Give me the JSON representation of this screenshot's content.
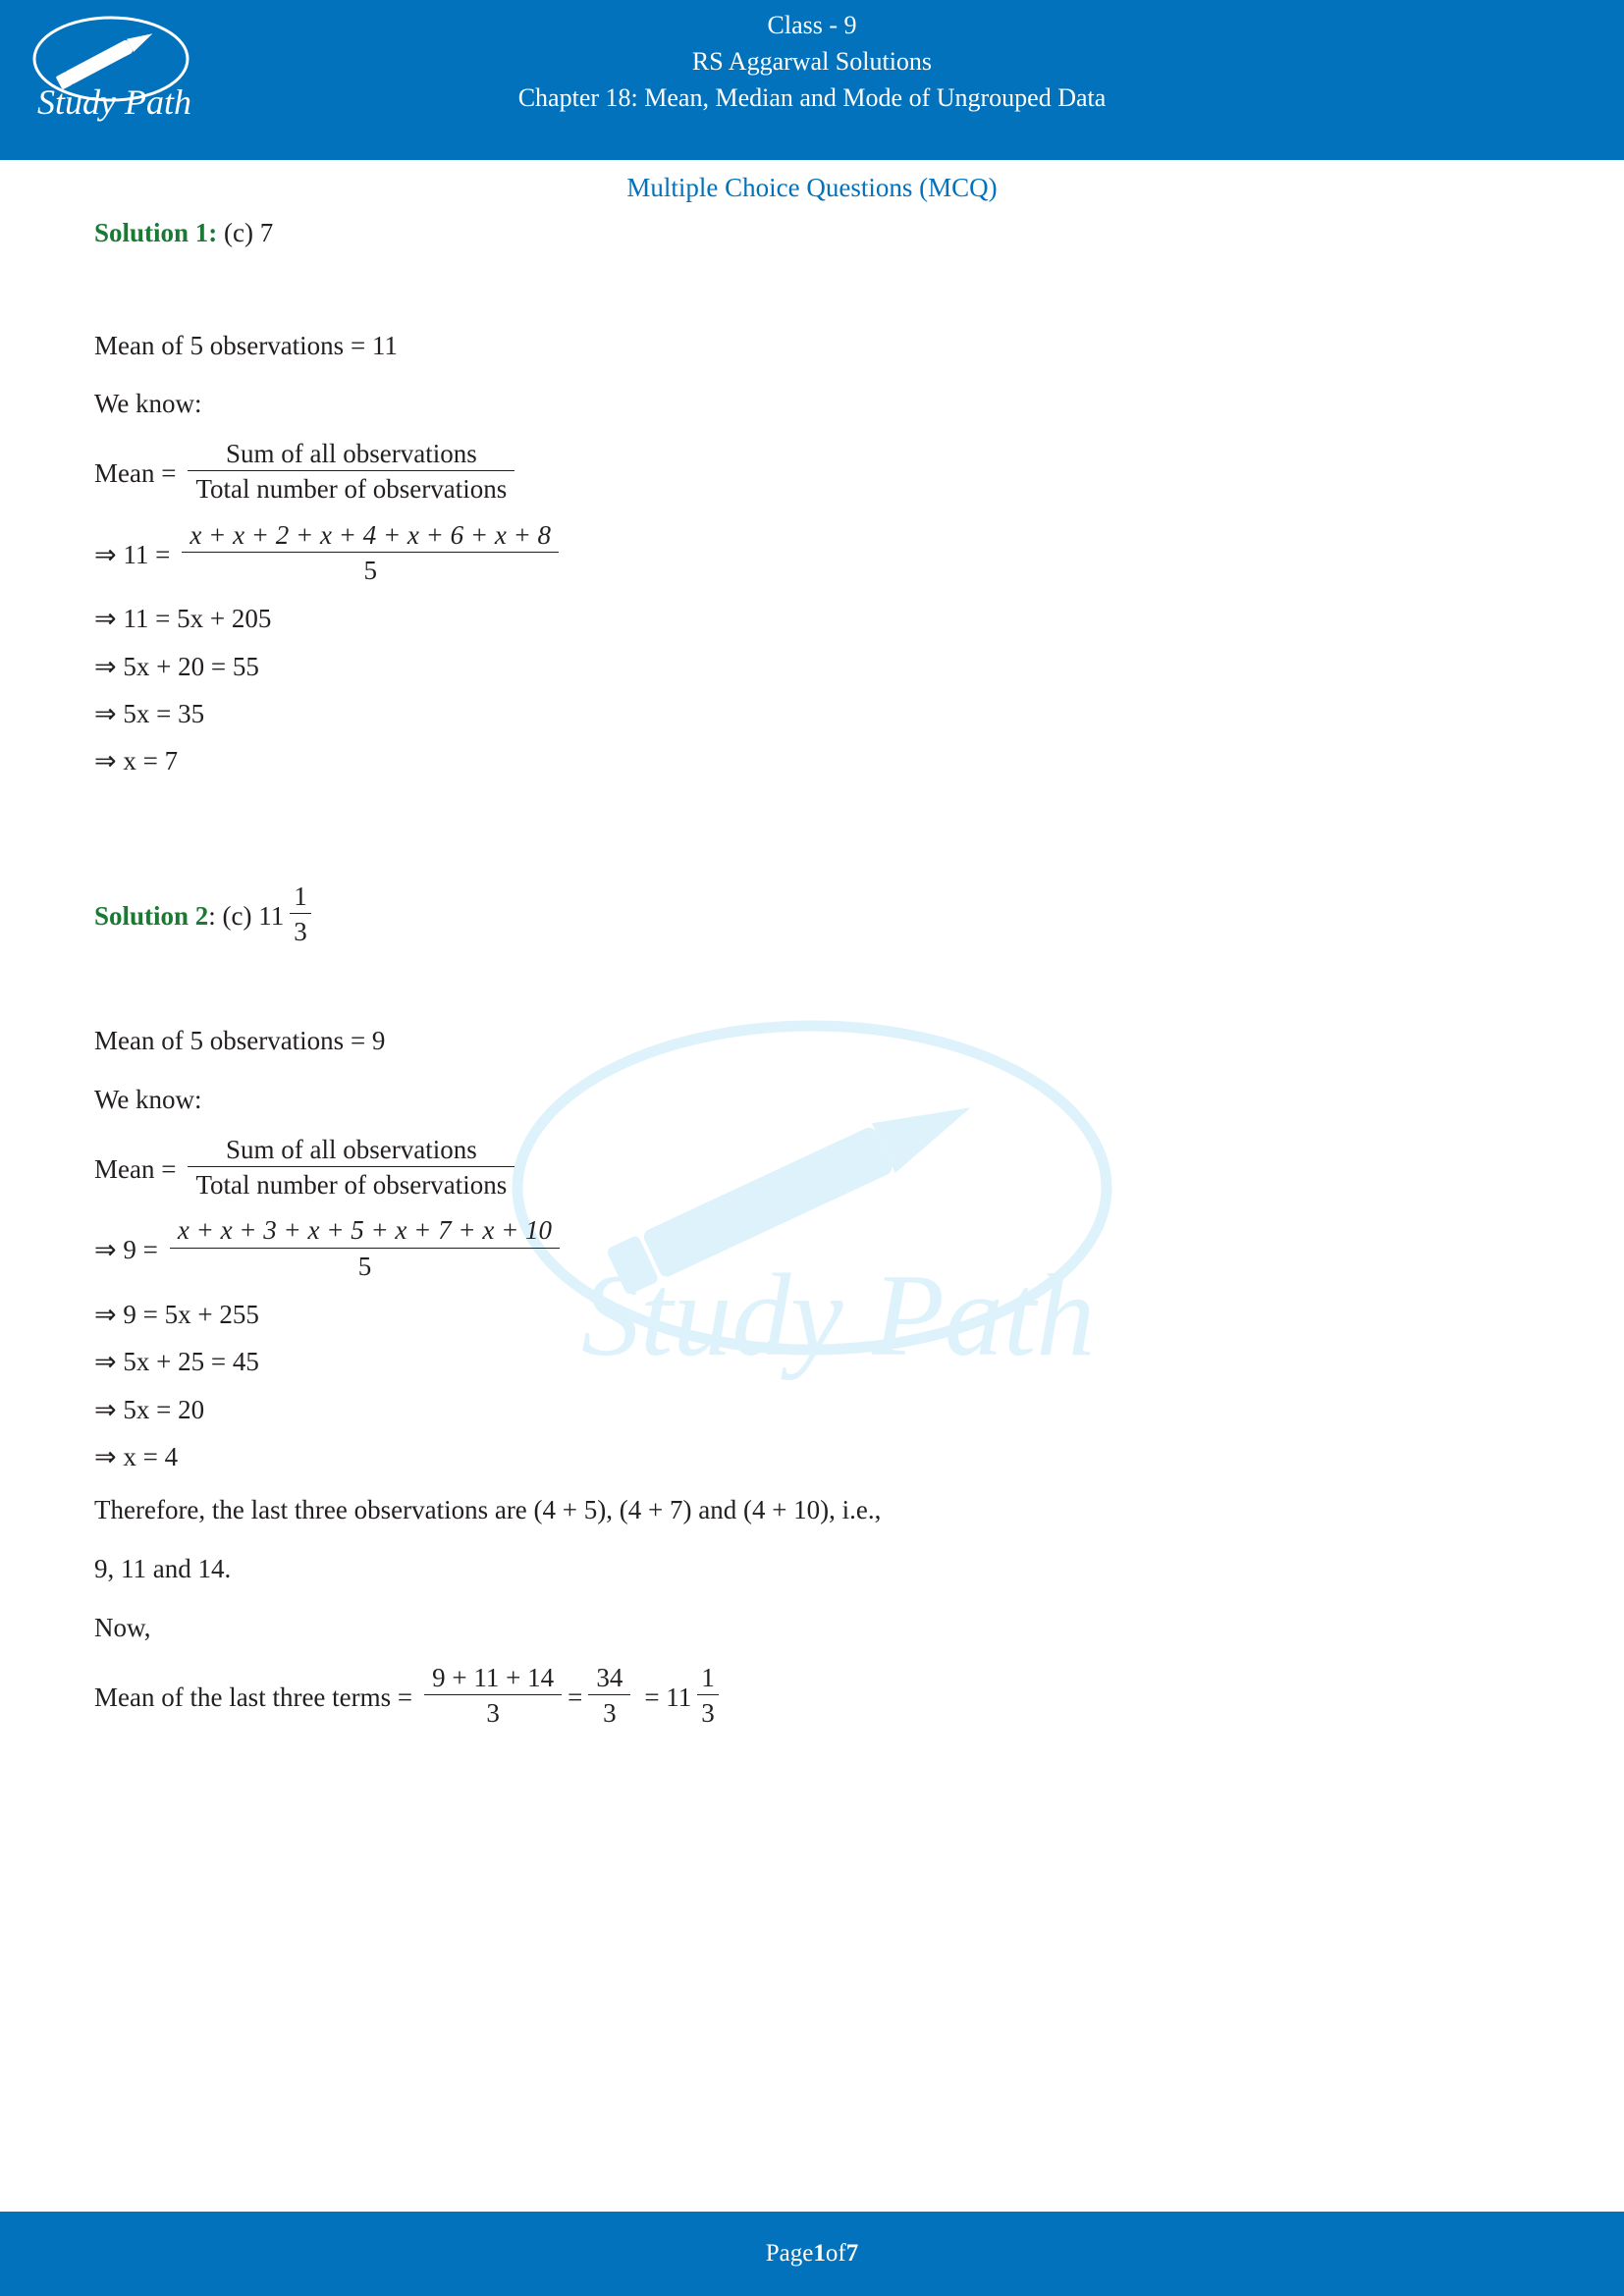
{
  "header": {
    "logo_text": "Study Path",
    "line1": "Class - 9",
    "line2": "RS Aggarwal Solutions",
    "line3": "Chapter 18: Mean, Median and Mode of Ungrouped Data"
  },
  "page": {
    "mcq_title": "Multiple Choice Questions (MCQ)"
  },
  "solution1": {
    "label": "Solution 1:",
    "answer": "(c) 7",
    "line_mean": "Mean of 5 observations = 11",
    "line_weknow": "We know:",
    "mean_word": "Mean =",
    "frac_num": "Sum of all observations",
    "frac_den": "Total number of observations",
    "step1_lead": "⇒ 11 =",
    "step1_num": "x + x + 2 + x + 4 + x + 6 + x + 8",
    "step1_den": "5",
    "step2": "⇒ 11 = 5x + 205",
    "step3": "⇒ 5x + 20 = 55",
    "step4": "⇒ 5x = 35",
    "step5": "⇒ x = 7"
  },
  "solution2": {
    "label": "Solution 2",
    "answer_prefix": ": (c) 11",
    "answer_frac_num": "1",
    "answer_frac_den": "3",
    "line_mean": "Mean of 5 observations = 9",
    "line_weknow": "We know:",
    "mean_word": "Mean =",
    "frac_num": "Sum of all observations",
    "frac_den": "Total number of observations",
    "step1_lead": "⇒ 9 =",
    "step1_num": "x + x + 3 + x + 5 + x + 7 + x + 10",
    "step1_den": "5",
    "step2": "⇒ 9 = 5x + 255",
    "step3": "⇒ 5x + 25 = 45",
    "step4": "⇒ 5x = 20",
    "step5": "⇒ x = 4",
    "therefore": "Therefore, the last three observations are (4 + 5), (4 + 7) and (4 + 10), i.e.,",
    "therefore2": "9, 11 and 14.",
    "now": "Now,",
    "last_lead": "Mean of the last three terms =",
    "last_num": "9 + 11 + 14",
    "last_den": "3",
    "eq1": "=",
    "f2_num": "34",
    "f2_den": "3",
    "eq2": "= 11",
    "f3_num": "1",
    "f3_den": "3"
  },
  "footer": {
    "prefix": "Page ",
    "current": "1",
    "middle": " of ",
    "total": "7"
  },
  "colors": {
    "brand_blue": "#0272bc",
    "solution_green": "#1a7a33",
    "text": "#231f20",
    "watermark": "#d9f1fb"
  }
}
